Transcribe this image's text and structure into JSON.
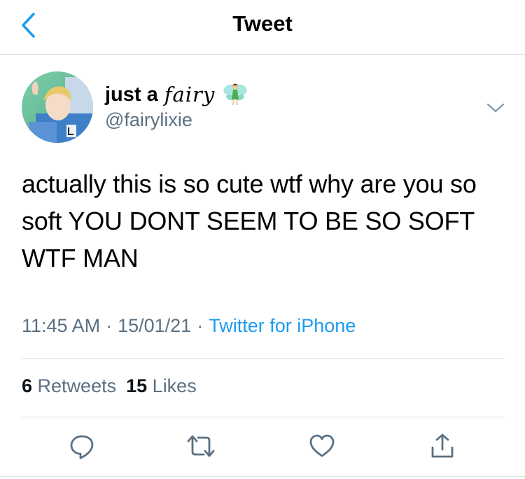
{
  "header": {
    "title": "Tweet",
    "back_icon": "chevron-left-icon"
  },
  "author": {
    "name_plain": "just a",
    "name_fancy": "fairy",
    "name_emoji": "fairy-emoji-icon",
    "handle": "@fairylixie"
  },
  "tweet": {
    "text": "actually this is so cute wtf why are you so soft YOU DONT SEEM TO BE SO SOFT WTF MAN"
  },
  "meta": {
    "time": "11:45 AM",
    "date": "15/01/21",
    "source": "Twitter for iPhone"
  },
  "stats": {
    "retweets_count": "6",
    "retweets_label": "Retweets",
    "likes_count": "15",
    "likes_label": "Likes"
  },
  "actions": [
    "reply-icon",
    "retweet-icon",
    "like-icon",
    "share-icon"
  ],
  "colors": {
    "accent": "#1d9bf0",
    "secondary_text": "#5b7083",
    "divider": "#d9dee3"
  }
}
